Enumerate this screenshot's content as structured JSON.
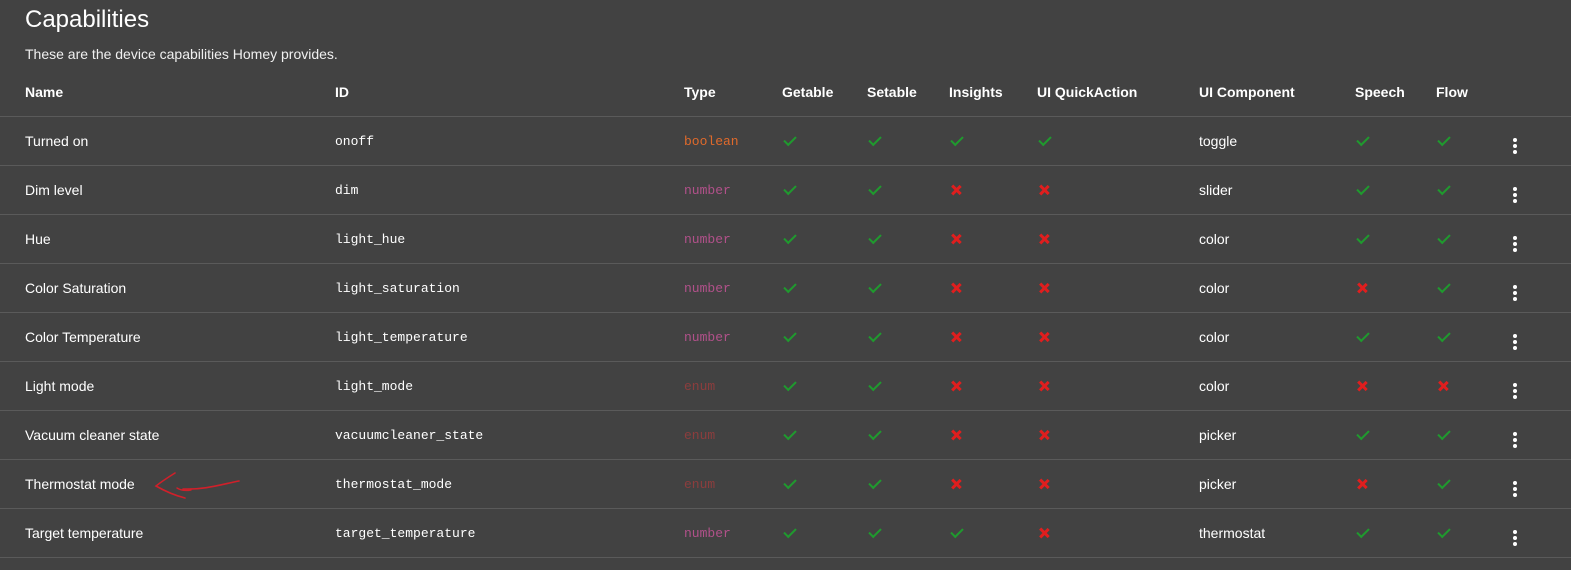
{
  "header": {
    "title": "Capabilities",
    "subtitle": "These are the device capabilities Homey provides."
  },
  "columns": {
    "name": "Name",
    "id": "ID",
    "type": "Type",
    "getable": "Getable",
    "setable": "Setable",
    "insights": "Insights",
    "quickaction": "UI QuickAction",
    "component": "UI Component",
    "speech": "Speech",
    "flow": "Flow"
  },
  "rows": [
    {
      "name": "Turned on",
      "id": "onoff",
      "type": "boolean",
      "getable": true,
      "setable": true,
      "insights": true,
      "quickaction": true,
      "component": "toggle",
      "speech": true,
      "flow": true
    },
    {
      "name": "Dim level",
      "id": "dim",
      "type": "number",
      "getable": true,
      "setable": true,
      "insights": false,
      "quickaction": false,
      "component": "slider",
      "speech": true,
      "flow": true
    },
    {
      "name": "Hue",
      "id": "light_hue",
      "type": "number",
      "getable": true,
      "setable": true,
      "insights": false,
      "quickaction": false,
      "component": "color",
      "speech": true,
      "flow": true
    },
    {
      "name": "Color Saturation",
      "id": "light_saturation",
      "type": "number",
      "getable": true,
      "setable": true,
      "insights": false,
      "quickaction": false,
      "component": "color",
      "speech": false,
      "flow": true
    },
    {
      "name": "Color Temperature",
      "id": "light_temperature",
      "type": "number",
      "getable": true,
      "setable": true,
      "insights": false,
      "quickaction": false,
      "component": "color",
      "speech": true,
      "flow": true
    },
    {
      "name": "Light mode",
      "id": "light_mode",
      "type": "enum",
      "getable": true,
      "setable": true,
      "insights": false,
      "quickaction": false,
      "component": "color",
      "speech": false,
      "flow": false
    },
    {
      "name": "Vacuum cleaner state",
      "id": "vacuumcleaner_state",
      "type": "enum",
      "getable": true,
      "setable": true,
      "insights": false,
      "quickaction": false,
      "component": "picker",
      "speech": true,
      "flow": true
    },
    {
      "name": "Thermostat mode",
      "id": "thermostat_mode",
      "type": "enum",
      "getable": true,
      "setable": true,
      "insights": false,
      "quickaction": false,
      "component": "picker",
      "speech": false,
      "flow": true
    },
    {
      "name": "Target temperature",
      "id": "target_temperature",
      "type": "number",
      "getable": true,
      "setable": true,
      "insights": true,
      "quickaction": false,
      "component": "thermostat",
      "speech": true,
      "flow": true
    }
  ],
  "colors": {
    "background": "#424242",
    "check": "#1f9a2e",
    "cross": "#e01e1e",
    "boolean": "#e06a2b",
    "number": "#b1518a",
    "enum": "#8c3d3d",
    "annotation_arrow": "#d0202a"
  },
  "icons": {
    "true": "check-icon",
    "false": "cross-icon",
    "row_menu": "more-vertical-icon",
    "annotation": "hand-drawn-arrow"
  }
}
